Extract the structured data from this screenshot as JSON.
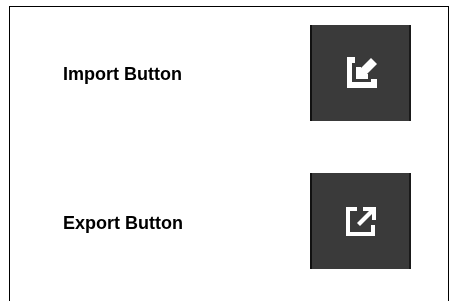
{
  "rows": [
    {
      "label": "Import Button",
      "icon": "import-icon"
    },
    {
      "label": "Export Button",
      "icon": "export-icon"
    }
  ],
  "colors": {
    "button_bg": "#3a3a3a",
    "icon_fg": "#ffffff"
  }
}
